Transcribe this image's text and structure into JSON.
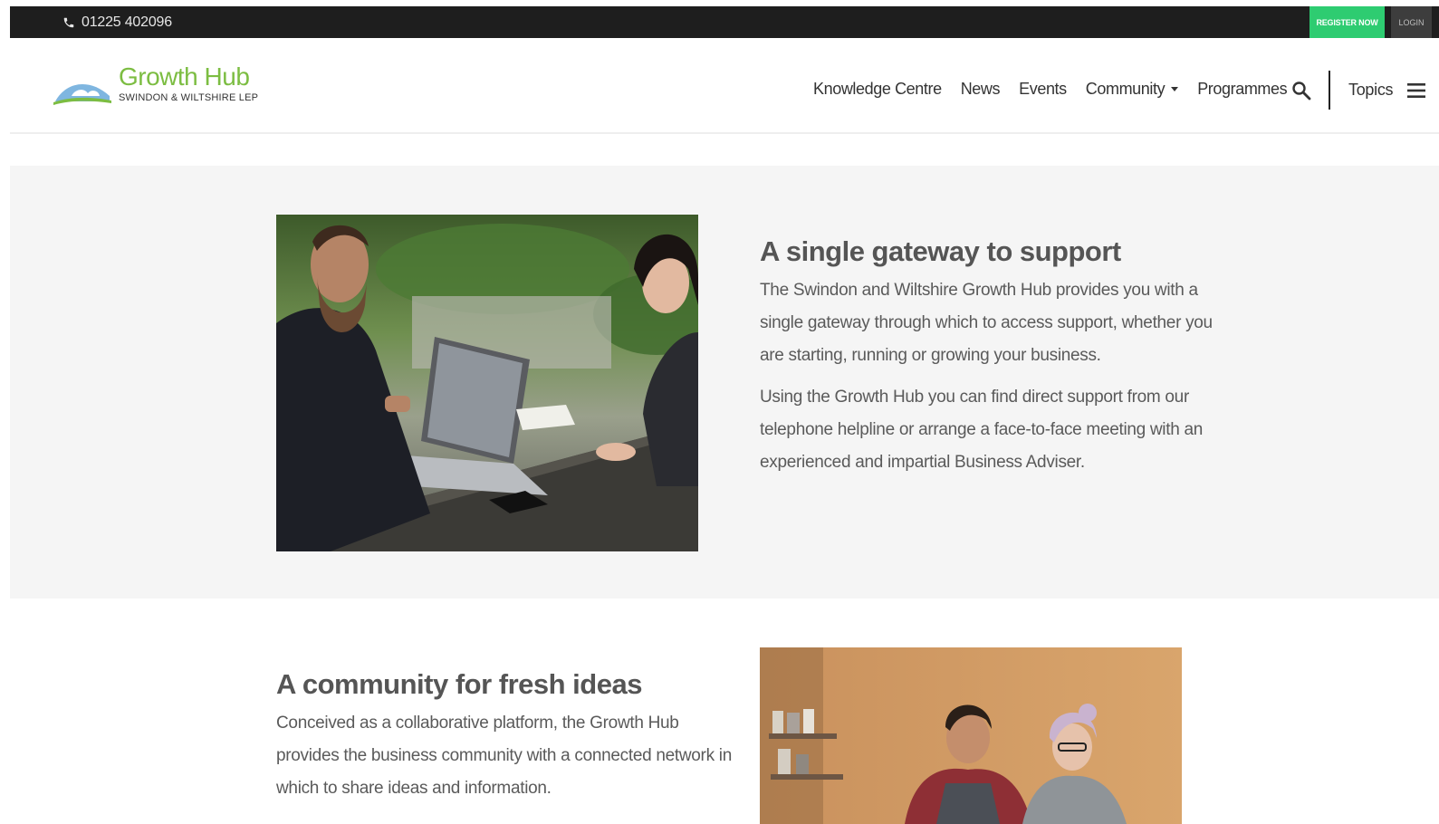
{
  "topbar": {
    "phone_icon": "phone-icon",
    "phone": "01225 402096",
    "register_label": "REGISTER NOW",
    "login_label": "LOGIN"
  },
  "header": {
    "logo_title": "Growth Hub",
    "logo_subtitle": "SWINDON & WILTSHIRE LEP",
    "nav": [
      {
        "label": "Knowledge Centre"
      },
      {
        "label": "News"
      },
      {
        "label": "Events"
      },
      {
        "label": "Community",
        "has_dropdown": true
      },
      {
        "label": "Programmes"
      }
    ],
    "search_icon": "search-icon",
    "topics_label": "Topics",
    "menu_icon": "hamburger-icon"
  },
  "section_gateway": {
    "heading": "A single gateway to support",
    "paragraphs": [
      "The Swindon and Wiltshire Growth Hub provides you with a single gateway through which to access support, whether you are starting, running or growing your business.",
      "Using the Growth Hub you can find direct support from our telephone helpline or arrange a face-to-face meeting with an experienced and impartial Business Adviser."
    ]
  },
  "section_community": {
    "heading": "A community for fresh ideas",
    "paragraphs": [
      "Conceived as a collaborative platform, the Growth Hub provides the business community with a connected network in which to share ideas and information."
    ]
  },
  "colors": {
    "topbar_bg": "#1e1e1e",
    "register_bg": "#2ecc71",
    "login_bg": "#3d3d3d",
    "brand_green": "#7cbd42",
    "section_bg": "#f5f5f5"
  }
}
